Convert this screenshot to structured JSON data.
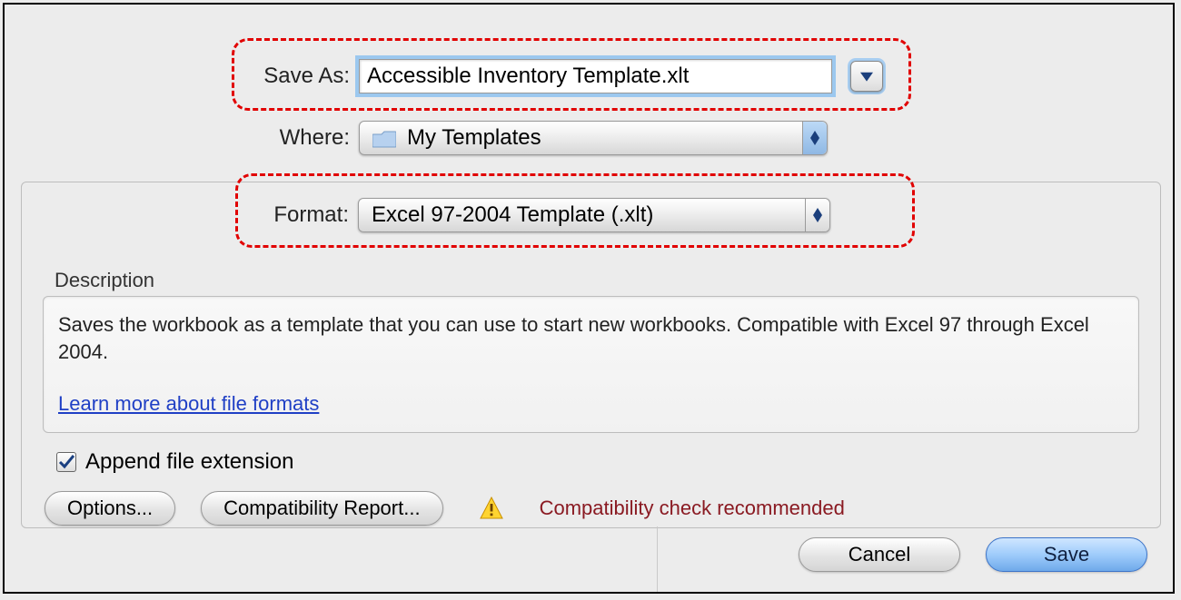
{
  "labels": {
    "save_as": "Save As:",
    "where": "Where:",
    "format": "Format:",
    "description_heading": "Description"
  },
  "save_as": {
    "value": "Accessible Inventory Template.xlt"
  },
  "where": {
    "selected": "My Templates"
  },
  "format": {
    "selected": "Excel 97-2004 Template (.xlt)"
  },
  "description": {
    "text": "Saves the workbook as a template that you can use to start new workbooks. Compatible with Excel 97 through Excel 2004.",
    "learn_more": "Learn more about file formats"
  },
  "append_extension": {
    "label": "Append file extension",
    "checked": true
  },
  "buttons": {
    "options": "Options...",
    "compat_report": "Compatibility Report...",
    "cancel": "Cancel",
    "save": "Save"
  },
  "compat_warning": "Compatibility check recommended"
}
